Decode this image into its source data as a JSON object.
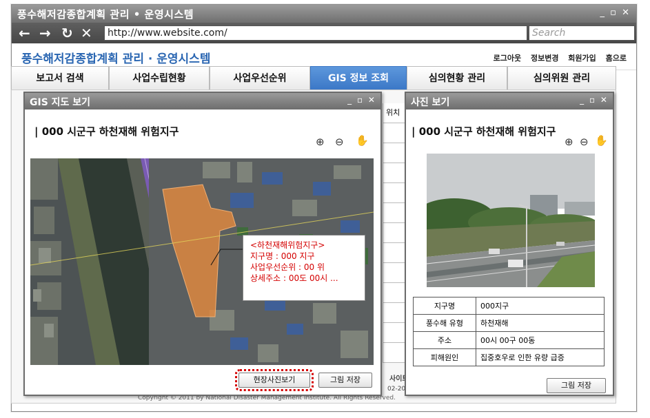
{
  "window": {
    "title": "풍수해저감종합계획 관리 • 운영시스템",
    "controls": "_ ▫ ✕"
  },
  "browser": {
    "url": "http://www.website.com/",
    "search_placeholder": "Search"
  },
  "site": {
    "brand": "풍수해저감종합계획 관리 · 운영시스템",
    "links": [
      "로그아웃",
      "정보변경",
      "회원가입",
      "홈으로"
    ]
  },
  "tabs": [
    {
      "label": "보고서 검색",
      "active": false
    },
    {
      "label": "사업수립현황",
      "active": false
    },
    {
      "label": "사업우선순위",
      "active": false
    },
    {
      "label": "GIS 정보 조회",
      "active": true
    },
    {
      "label": "심의현황 관리",
      "active": false
    },
    {
      "label": "심의위원 관리",
      "active": false
    }
  ],
  "background": {
    "column_header": "위치",
    "footer_site": "사이트",
    "footer_year": "02-20",
    "copyright": "Copyright © 2011 by National Disaster Management Institute. All Rights Reserved."
  },
  "gis_popup": {
    "title": "GIS 지도 보기",
    "controls": "_ ▫ ✕",
    "subtitle": "| 000 시군구 하천재해 위험지구",
    "callout": {
      "line1": "<하천재해위험지구>",
      "line2": "지구명 : 000 지구",
      "line3": "사업우선순위 : 00 위",
      "line4": "상세주소 : 00도 00시 ..."
    },
    "photo_button": "현장사진보기",
    "save_button": "그림 저장"
  },
  "photo_popup": {
    "title": "사진 보기",
    "controls": "_ ▫ ✕",
    "subtitle": "| 000 시군구 하천재해 위험지구",
    "table": [
      {
        "key": "지구명",
        "value": "000지구"
      },
      {
        "key": "풍수해 유형",
        "value": "하천재해"
      },
      {
        "key": "주소",
        "value": "00시 00구 00동"
      },
      {
        "key": "피해원인",
        "value": "집중호우로 인한 유량 급증"
      }
    ],
    "save_button": "그림 저장"
  },
  "colors": {
    "accent_blue": "#3a77c6",
    "brand_text": "#2a66b2",
    "callout_red": "#d40000",
    "highlight_zone": "#e88a3c"
  }
}
